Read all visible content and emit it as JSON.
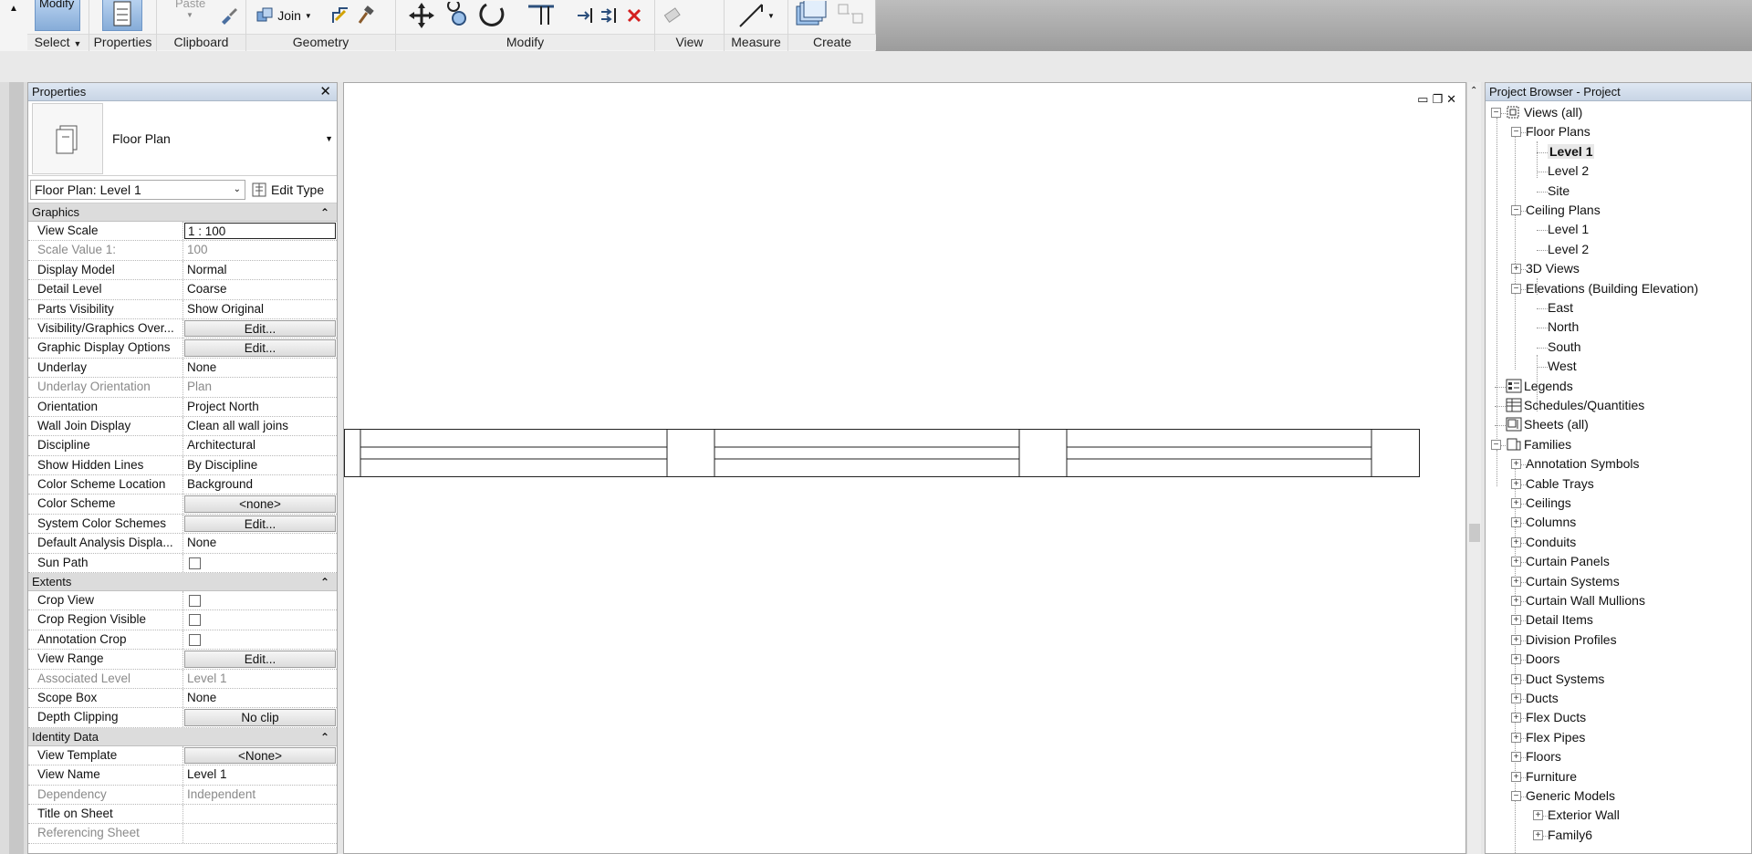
{
  "ribbon": {
    "panels": {
      "select": "Select",
      "properties": "Properties",
      "clipboard": "Clipboard",
      "geometry": "Geometry",
      "modify": "Modify",
      "view": "View",
      "measure": "Measure",
      "create": "Create"
    },
    "modify_button": "Modify",
    "paste_label": "Paste",
    "join_label": "Join"
  },
  "properties": {
    "title": "Properties",
    "type_name": "Floor Plan",
    "instance": "Floor Plan: Level 1",
    "edit_type": "Edit Type",
    "groups": [
      {
        "name": "Graphics",
        "rows": [
          {
            "name": "View Scale",
            "value": "1 : 100",
            "kind": "field"
          },
          {
            "name": "Scale Value    1:",
            "value": "100",
            "kind": "disabled"
          },
          {
            "name": "Display Model",
            "value": "Normal",
            "kind": "text"
          },
          {
            "name": "Detail Level",
            "value": "Coarse",
            "kind": "text"
          },
          {
            "name": "Parts Visibility",
            "value": "Show Original",
            "kind": "text"
          },
          {
            "name": "Visibility/Graphics Over...",
            "value": "Edit...",
            "kind": "button"
          },
          {
            "name": "Graphic Display Options",
            "value": "Edit...",
            "kind": "button"
          },
          {
            "name": "Underlay",
            "value": "None",
            "kind": "text"
          },
          {
            "name": "Underlay Orientation",
            "value": "Plan",
            "kind": "disabled"
          },
          {
            "name": "Orientation",
            "value": "Project North",
            "kind": "text"
          },
          {
            "name": "Wall Join Display",
            "value": "Clean all wall joins",
            "kind": "text"
          },
          {
            "name": "Discipline",
            "value": "Architectural",
            "kind": "text"
          },
          {
            "name": "Show Hidden Lines",
            "value": "By Discipline",
            "kind": "text"
          },
          {
            "name": "Color Scheme Location",
            "value": "Background",
            "kind": "text"
          },
          {
            "name": "Color Scheme",
            "value": "<none>",
            "kind": "button"
          },
          {
            "name": "System Color Schemes",
            "value": "Edit...",
            "kind": "button"
          },
          {
            "name": "Default Analysis Displa...",
            "value": "None",
            "kind": "text"
          },
          {
            "name": "Sun Path",
            "value": "",
            "kind": "check"
          }
        ]
      },
      {
        "name": "Extents",
        "rows": [
          {
            "name": "Crop View",
            "value": "",
            "kind": "check"
          },
          {
            "name": "Crop Region Visible",
            "value": "",
            "kind": "check"
          },
          {
            "name": "Annotation Crop",
            "value": "",
            "kind": "check"
          },
          {
            "name": "View Range",
            "value": "Edit...",
            "kind": "button"
          },
          {
            "name": "Associated Level",
            "value": "Level 1",
            "kind": "disabled"
          },
          {
            "name": "Scope Box",
            "value": "None",
            "kind": "text"
          },
          {
            "name": "Depth Clipping",
            "value": "No clip",
            "kind": "button"
          }
        ]
      },
      {
        "name": "Identity Data",
        "rows": [
          {
            "name": "View Template",
            "value": "<None>",
            "kind": "button"
          },
          {
            "name": "View Name",
            "value": "Level 1",
            "kind": "text"
          },
          {
            "name": "Dependency",
            "value": "Independent",
            "kind": "disabled"
          },
          {
            "name": "Title on Sheet",
            "value": "",
            "kind": "text"
          },
          {
            "name": "Referencing Sheet",
            "value": "",
            "kind": "disabled"
          }
        ]
      }
    ]
  },
  "browser": {
    "title": "Project Browser - Project",
    "nodes": [
      {
        "label": "Views (all)",
        "depth": 0,
        "toggle": "-",
        "icon": "views"
      },
      {
        "label": "Floor Plans",
        "depth": 1,
        "toggle": "-"
      },
      {
        "label": "Level 1",
        "depth": 2,
        "toggle": "",
        "bold": true
      },
      {
        "label": "Level 2",
        "depth": 2,
        "toggle": ""
      },
      {
        "label": "Site",
        "depth": 2,
        "toggle": ""
      },
      {
        "label": "Ceiling Plans",
        "depth": 1,
        "toggle": "-"
      },
      {
        "label": "Level 1",
        "depth": 2,
        "toggle": ""
      },
      {
        "label": "Level 2",
        "depth": 2,
        "toggle": ""
      },
      {
        "label": "3D Views",
        "depth": 1,
        "toggle": "+"
      },
      {
        "label": "Elevations (Building Elevation)",
        "depth": 1,
        "toggle": "-"
      },
      {
        "label": "East",
        "depth": 2,
        "toggle": ""
      },
      {
        "label": "North",
        "depth": 2,
        "toggle": ""
      },
      {
        "label": "South",
        "depth": 2,
        "toggle": ""
      },
      {
        "label": "West",
        "depth": 2,
        "toggle": ""
      },
      {
        "label": "Legends",
        "depth": 0,
        "toggle": "",
        "icon": "legend"
      },
      {
        "label": "Schedules/Quantities",
        "depth": 0,
        "toggle": "",
        "icon": "schedule"
      },
      {
        "label": "Sheets (all)",
        "depth": 0,
        "toggle": "",
        "icon": "sheet"
      },
      {
        "label": "Families",
        "depth": 0,
        "toggle": "-",
        "icon": "family"
      },
      {
        "label": "Annotation Symbols",
        "depth": 1,
        "toggle": "+"
      },
      {
        "label": "Cable Trays",
        "depth": 1,
        "toggle": "+"
      },
      {
        "label": "Ceilings",
        "depth": 1,
        "toggle": "+"
      },
      {
        "label": "Columns",
        "depth": 1,
        "toggle": "+"
      },
      {
        "label": "Conduits",
        "depth": 1,
        "toggle": "+"
      },
      {
        "label": "Curtain Panels",
        "depth": 1,
        "toggle": "+"
      },
      {
        "label": "Curtain Systems",
        "depth": 1,
        "toggle": "+"
      },
      {
        "label": "Curtain Wall Mullions",
        "depth": 1,
        "toggle": "+"
      },
      {
        "label": "Detail Items",
        "depth": 1,
        "toggle": "+"
      },
      {
        "label": "Division Profiles",
        "depth": 1,
        "toggle": "+"
      },
      {
        "label": "Doors",
        "depth": 1,
        "toggle": "+"
      },
      {
        "label": "Duct Systems",
        "depth": 1,
        "toggle": "+"
      },
      {
        "label": "Ducts",
        "depth": 1,
        "toggle": "+"
      },
      {
        "label": "Flex Ducts",
        "depth": 1,
        "toggle": "+"
      },
      {
        "label": "Flex Pipes",
        "depth": 1,
        "toggle": "+"
      },
      {
        "label": "Floors",
        "depth": 1,
        "toggle": "+"
      },
      {
        "label": "Furniture",
        "depth": 1,
        "toggle": "+"
      },
      {
        "label": "Generic Models",
        "depth": 1,
        "toggle": "-"
      },
      {
        "label": "Exterior Wall",
        "depth": 2,
        "toggle": "+"
      },
      {
        "label": "Family6",
        "depth": 2,
        "toggle": "+"
      }
    ]
  },
  "colors": {
    "accent": "#86acd8",
    "delete_red": "#d42020"
  }
}
